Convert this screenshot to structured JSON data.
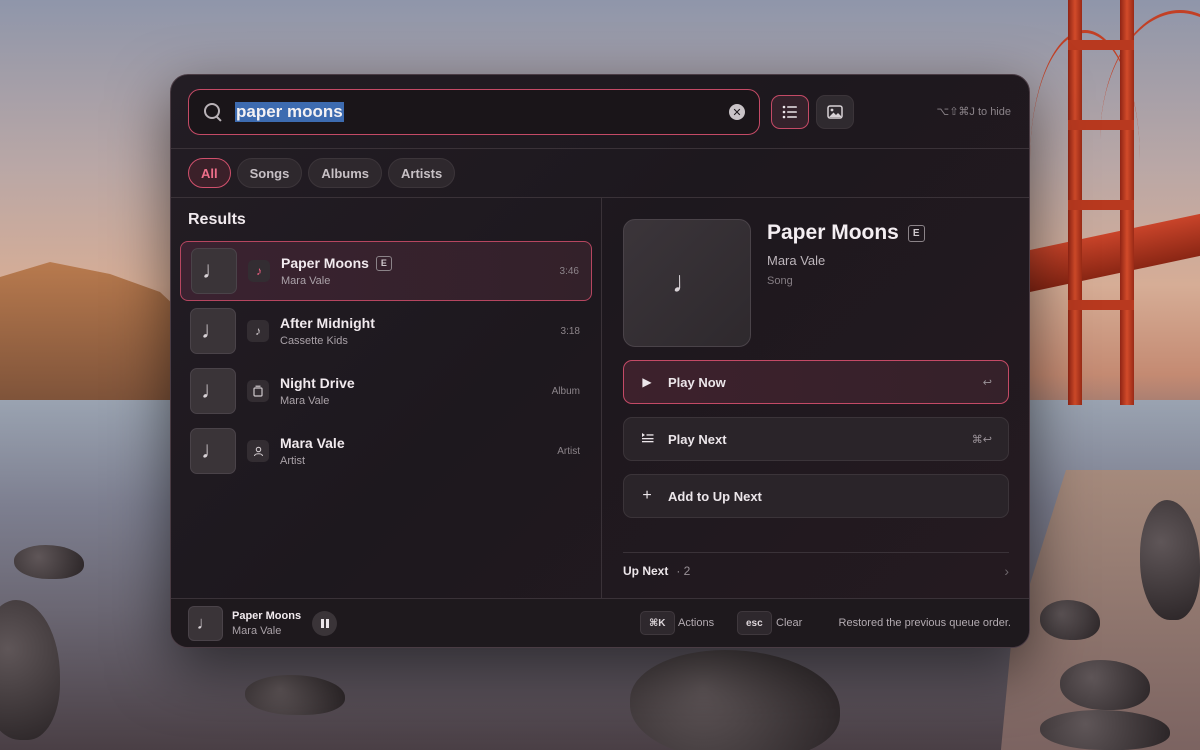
{
  "colors": {
    "accent": "#c44a66",
    "accent_text": "#ee6f8a",
    "panel": "#1d181e"
  },
  "search": {
    "value": "paper moons",
    "clear_icon": "clear-circle-icon"
  },
  "view_toggle": {
    "list_icon": "list-icon",
    "grid_icon": "image-icon"
  },
  "hint": "⌥⇧⌘J to hide",
  "filters": [
    "All",
    "Songs",
    "Albums",
    "Artists"
  ],
  "results": {
    "title": "Results",
    "items": [
      {
        "title": "Paper Moons",
        "subtitle": "Mara Vale",
        "meta": "3:46",
        "explicit": "E",
        "icon": "music-note-icon"
      },
      {
        "title": "After Midnight",
        "subtitle": "Cassette Kids",
        "meta": "3:18",
        "icon": "music-note-icon"
      },
      {
        "title": "Night Drive",
        "subtitle": "Mara Vale",
        "meta": "Album",
        "icon": "album-icon"
      },
      {
        "title": "Mara Vale",
        "subtitle": "Artist",
        "meta": "Artist",
        "icon": "person-icon"
      }
    ]
  },
  "detail": {
    "title": "Paper Moons",
    "explicit": "E",
    "artist": "Mara Vale",
    "kind": "Song",
    "actions": [
      {
        "label": "Play Now",
        "shortcut": "↩",
        "icon": "play-icon"
      },
      {
        "label": "Play Next",
        "shortcut": "⌘↩",
        "icon": "play-next-icon"
      },
      {
        "label": "Add to Up Next",
        "shortcut": "",
        "icon": "plus-icon"
      }
    ],
    "up_next": {
      "label": "Up Next",
      "count": "· 2"
    }
  },
  "footer": {
    "now_playing_title": "Paper Moons",
    "now_playing_artist": "Mara Vale",
    "actions_key": "⌘K",
    "actions_label": "Actions",
    "clear_key": "esc",
    "clear_label": "Clear",
    "status": "Restored the previous queue order."
  }
}
